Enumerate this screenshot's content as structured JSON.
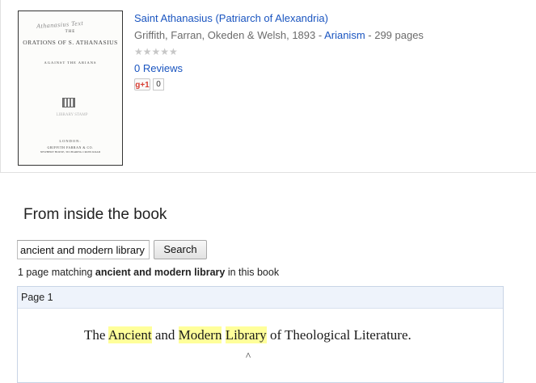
{
  "book": {
    "title": "Saint Athanasius (Patriarch of Alexandria)",
    "meta_prefix": "Griffith, Farran, Okeden & Welsh, 1893 - ",
    "category": "Arianism",
    "meta_suffix": " - 299 pages",
    "stars": "★★★★★",
    "reviews": "0 Reviews",
    "gplus_label": "g+1",
    "gplus_count": "0"
  },
  "cover": {
    "handwriting": "Athanasius Text",
    "the": "THE",
    "orations": "ORATIONS OF S. ATHANASIUS",
    "against": "AGAINST THE ARIANS",
    "stamp": "LIBRARY STAMP",
    "london": "LONDON:",
    "publisher": "GRIFFITH FARRAN & CO.",
    "address": "NEWBERY HOUSE, 39 CHARING CROSS ROAD"
  },
  "inside": {
    "heading": "From inside the book",
    "search_value": "ancient and modern library",
    "search_button": "Search",
    "match_prefix": "1 page matching ",
    "match_query": "ancient and modern library",
    "match_suffix": " in this book"
  },
  "result": {
    "page_label": "Page 1",
    "snippet": {
      "pre": "The ",
      "hl1": "Ancient",
      "mid1": " and ",
      "hl2": "Modern",
      "mid2": " ",
      "hl3": "Library",
      "post": " of Theological Literature."
    },
    "caret": "^"
  },
  "colors": {
    "link": "#1a55c0",
    "highlight": "#ffff9a",
    "result_header_bg": "#eef3fb"
  }
}
